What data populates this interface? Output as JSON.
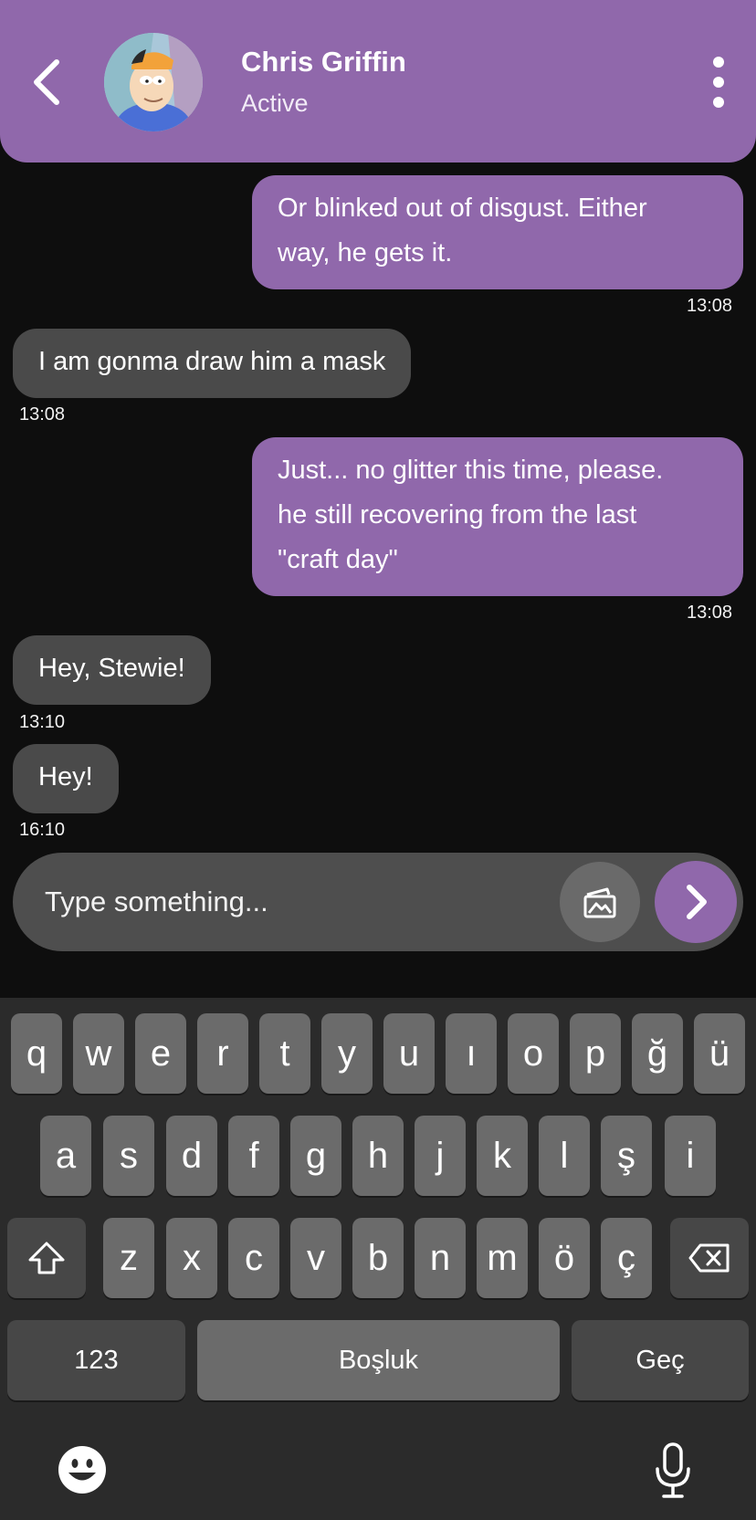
{
  "header": {
    "name": "Chris Griffin",
    "status": "Active",
    "accent_color": "#9068ab"
  },
  "messages": [
    {
      "direction": "sent",
      "lines": [
        "Or blinked out of disgust. Either",
        "way, he gets it."
      ],
      "time": "13:08"
    },
    {
      "direction": "received",
      "lines": [
        "I am gonma draw him a mask"
      ],
      "time": "13:08"
    },
    {
      "direction": "sent",
      "lines": [
        "Just... no glitter this time, please.",
        "he still recovering from the last",
        "\"craft day\""
      ],
      "time": "13:08"
    },
    {
      "direction": "received",
      "lines": [
        "Hey, Stewie!"
      ],
      "time": "13:10"
    },
    {
      "direction": "received",
      "lines": [
        "Hey!"
      ],
      "time": "16:10"
    }
  ],
  "composer": {
    "placeholder": "Type something...",
    "gallery_icon": "image-gallery-icon",
    "send_icon": "chevron-right-icon"
  },
  "keyboard": {
    "row1": [
      "q",
      "w",
      "e",
      "r",
      "t",
      "y",
      "u",
      "ı",
      "o",
      "p",
      "ğ",
      "ü"
    ],
    "row2": [
      "a",
      "s",
      "d",
      "f",
      "g",
      "h",
      "j",
      "k",
      "l",
      "ş",
      "i"
    ],
    "row3": [
      "z",
      "x",
      "c",
      "v",
      "b",
      "n",
      "m",
      "ö",
      "ç"
    ],
    "numbers_label": "123",
    "space_label": "Boşluk",
    "return_label": "Geç",
    "shift_icon": "shift-icon",
    "backspace_icon": "backspace-icon",
    "emoji_icon": "emoji-icon",
    "mic_icon": "microphone-icon"
  }
}
